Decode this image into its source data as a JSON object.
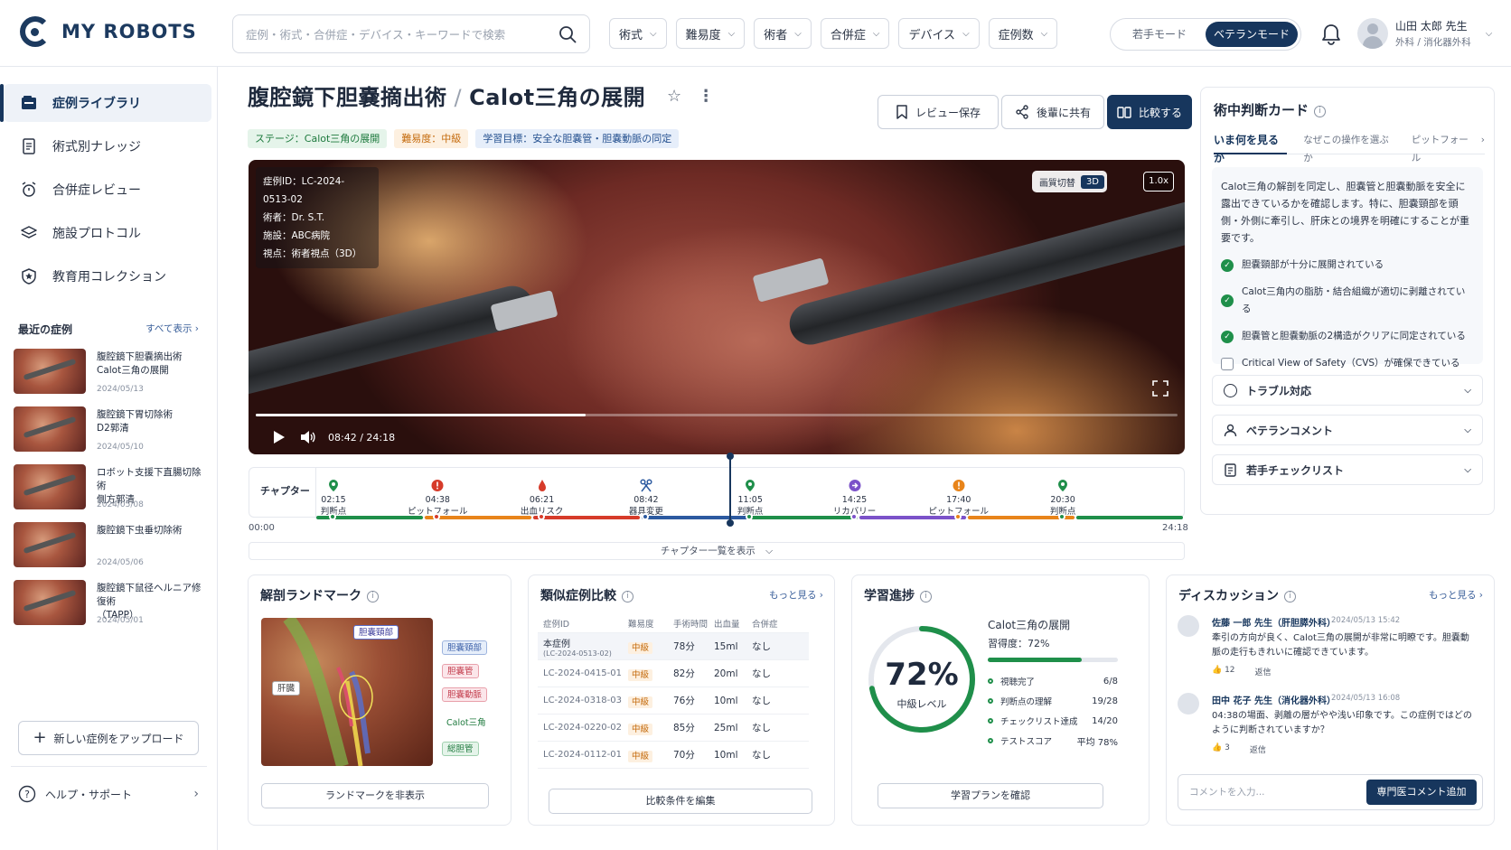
{
  "brand": {
    "name": "MY ROBOTS",
    "accent": "#17365d"
  },
  "search": {
    "placeholder": "症例・術式・合併症・デバイス・キーワードで検索"
  },
  "filters": [
    "術式",
    "難易度",
    "術者",
    "合併症",
    "デバイス",
    "症例数"
  ],
  "modes": {
    "junior": "若手モード",
    "veteran": "ベテランモード",
    "active": "veteran"
  },
  "user": {
    "name": "山田 太郎 先生",
    "dept": "外科 / 消化器外科"
  },
  "sidebar": {
    "items": [
      {
        "label": "症例ライブラリ",
        "icon": "library-icon",
        "active": true
      },
      {
        "label": "術式別ナレッジ",
        "icon": "document-icon",
        "active": false
      },
      {
        "label": "合併症レビュー",
        "icon": "alarm-icon",
        "active": false
      },
      {
        "label": "施設プロトコル",
        "icon": "layers-icon",
        "active": false
      },
      {
        "label": "教育用コレクション",
        "icon": "shield-star-icon",
        "active": false
      }
    ],
    "recent_title": "最近の症例",
    "recent_all": "すべて表示 ›",
    "recent": [
      {
        "title": "腹腔鏡下胆嚢摘出術\nCalot三角の展開",
        "date": "2024/05/13"
      },
      {
        "title": "腹腔鏡下胃切除術\nD2郭清",
        "date": "2024/05/10"
      },
      {
        "title": "ロボット支援下直腸切除術\n側方郭清",
        "date": "2024/05/08"
      },
      {
        "title": "腹腔鏡下虫垂切除術",
        "date": "2024/05/06"
      },
      {
        "title": "腹腔鏡下鼠径ヘルニア修復術\n（TAPP）",
        "date": "2024/05/01"
      }
    ],
    "upload": "新しい症例をアップロード",
    "help": "ヘルプ・サポート"
  },
  "page": {
    "title_main": "腹腔鏡下胆嚢摘出術",
    "title_sub": "Calot三角の展開",
    "tags": [
      "ステージ：Calot三角の展開",
      "難易度：中級",
      "学習目標：安全な胆嚢管・胆嚢動脈の同定"
    ],
    "actions": {
      "save": "レビュー保存",
      "share": "後輩に共有",
      "compare": "比較する"
    }
  },
  "video": {
    "info": [
      "症例ID：LC-2024-0513-02",
      "術者：Dr. S.T.",
      "施設：ABC病院",
      "視点：術者視点（3D）"
    ],
    "quality_label": "画質切替",
    "mode_3d": "3D",
    "speed": "1.0x",
    "time": "08:42 / 24:18",
    "progress": 0.358
  },
  "chapters": {
    "label": "チャプター",
    "start": "00:00",
    "end": "24:18",
    "list_button": "チャプター一覧を表示",
    "markers": [
      {
        "time": "02:15",
        "label": "判断点",
        "type": "pin",
        "color": "#1f8f4a"
      },
      {
        "time": "04:38",
        "label": "ピットフォール",
        "type": "alert",
        "color": "#d63b2a"
      },
      {
        "time": "06:21",
        "label": "出血リスク",
        "type": "drop",
        "color": "#d63b2a"
      },
      {
        "time": "08:42",
        "label": "器具変更",
        "type": "tool",
        "color": "#2c5aa0"
      },
      {
        "time": "11:05",
        "label": "判断点",
        "type": "pin",
        "color": "#1f8f4a"
      },
      {
        "time": "14:25",
        "label": "リカバリー",
        "type": "recover",
        "color": "#7b52c9"
      },
      {
        "time": "17:40",
        "label": "ピットフォール",
        "type": "alert",
        "color": "#e8841a"
      },
      {
        "time": "20:30",
        "label": "判断点",
        "type": "pin",
        "color": "#1f8f4a"
      }
    ],
    "segments": [
      {
        "color": "#1f8f4a"
      },
      {
        "color": "#e8841a"
      },
      {
        "color": "#d63b2a"
      },
      {
        "color": "#2c5aa0"
      },
      {
        "color": "#1f8f4a"
      },
      {
        "color": "#7b52c9"
      },
      {
        "color": "#e8841a"
      },
      {
        "color": "#1f8f4a"
      }
    ]
  },
  "judgement": {
    "title": "術中判断カード",
    "tabs": [
      "いま何を見るか",
      "なぜこの操作を選ぶか",
      "ピットフォール"
    ],
    "body": "Calot三角の解剖を同定し、胆嚢管と胆嚢動脈を安全に露出できているかを確認します。特に、胆嚢頸部を頭側・外側に牽引し、肝床との境界を明確にすることが重要です。",
    "checks": [
      {
        "label": "胆嚢頸部が十分に展開されている",
        "done": true
      },
      {
        "label": "Calot三角内の脂肪・結合組織が適切に剥離されている",
        "done": true
      },
      {
        "label": "胆嚢管と胆嚢動脈の2構造がクリアに同定されている",
        "done": true
      },
      {
        "label": "Critical View of Safety（CVS）が確保できている",
        "done": false
      }
    ],
    "accordions": [
      "トラブル対応",
      "ベテランコメント",
      "若手チェックリスト"
    ]
  },
  "landmarks": {
    "title": "解剖ランドマーク",
    "labels": [
      "胆嚢頸部",
      "胆嚢頸部",
      "胆嚢管",
      "胆嚢動脈",
      "Calot三角",
      "総胆管",
      "肝臓"
    ],
    "button": "ランドマークを非表示"
  },
  "similar": {
    "title": "類似症例比較",
    "more": "もっと見る ›",
    "headers": [
      "症例ID",
      "難易度",
      "手術時間",
      "出血量",
      "合併症"
    ],
    "rows": [
      {
        "id": "本症例",
        "sub": "(LC-2024-0513-02)",
        "level": "中級",
        "time": "78分",
        "blood": "15ml",
        "comp": "なし"
      },
      {
        "id": "LC-2024-0415-01",
        "sub": "",
        "level": "中級",
        "time": "82分",
        "blood": "20ml",
        "comp": "なし"
      },
      {
        "id": "LC-2024-0318-03",
        "sub": "",
        "level": "中級",
        "time": "76分",
        "blood": "10ml",
        "comp": "なし"
      },
      {
        "id": "LC-2024-0220-02",
        "sub": "",
        "level": "中級",
        "time": "85分",
        "blood": "25ml",
        "comp": "なし"
      },
      {
        "id": "LC-2024-0112-01",
        "sub": "",
        "level": "中級",
        "time": "70分",
        "blood": "10ml",
        "comp": "なし"
      }
    ],
    "button": "比較条件を編集"
  },
  "progress": {
    "title": "学習進捗",
    "percent": "72%",
    "value": 0.72,
    "level": "中級レベル",
    "topic": "Calot三角の展開",
    "mastery": "習得度：72%",
    "stats": [
      {
        "label": "視聴完了",
        "value": "6/8"
      },
      {
        "label": "判断点の理解",
        "value": "19/28"
      },
      {
        "label": "チェックリスト達成",
        "value": "14/20"
      },
      {
        "label": "テストスコア",
        "value": "平均 78%"
      }
    ],
    "button": "学習プランを確認"
  },
  "discussion": {
    "title": "ディスカッション",
    "more": "もっと見る ›",
    "comments": [
      {
        "name": "佐藤 一郎 先生（肝胆膵外科）",
        "time": "2024/05/13 15:42",
        "body": "牽引の方向が良く、Calot三角の展開が非常に明瞭です。胆嚢動脈の走行もきれいに確認できています。",
        "likes": "12",
        "reply": "返信"
      },
      {
        "name": "田中 花子 先生（消化器外科）",
        "time": "2024/05/13 16:08",
        "body": "04:38の場面、剥離の層がやや浅い印象です。この症例ではどのように判断されていますか？",
        "likes": "3",
        "reply": "返信"
      }
    ],
    "input_placeholder": "コメントを入力...",
    "send": "専門医コメント追加"
  }
}
